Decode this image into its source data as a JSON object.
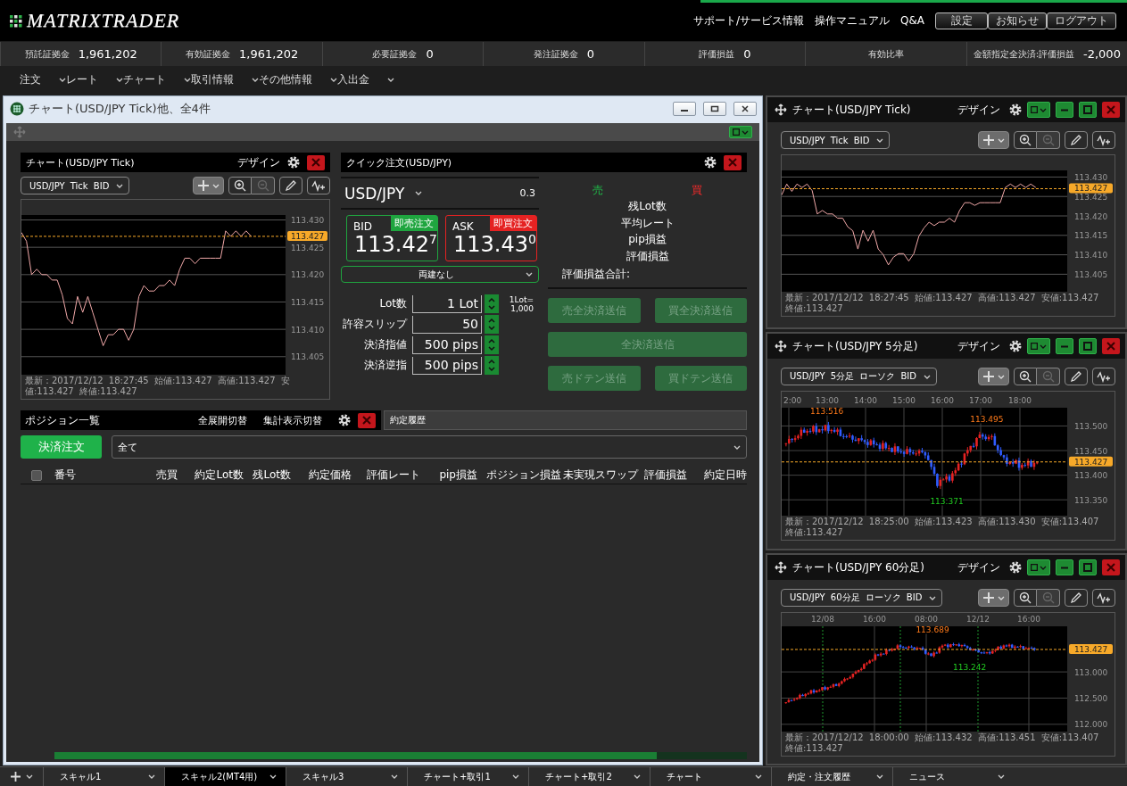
{
  "header": {
    "logo": "MATRIXTRADER",
    "links": [
      "サポート/サービス情報",
      "操作マニュアル",
      "Q&A"
    ],
    "buttons": [
      "設定",
      "お知らせ",
      "ログアウト"
    ]
  },
  "account": [
    {
      "label": "預託証拠金",
      "value": "1,961,202"
    },
    {
      "label": "有効証拠金",
      "value": "1,961,202"
    },
    {
      "label": "必要証拠金",
      "value": "0"
    },
    {
      "label": "発注証拠金",
      "value": "0"
    },
    {
      "label": "評価損益",
      "value": "0"
    },
    {
      "label": "有効比率"
    },
    {
      "label": "金額指定全決済:評価損益",
      "value": "-2,000"
    }
  ],
  "menu": [
    "注文",
    "レート",
    "チャート",
    "取引情報",
    "その他情報",
    "入出金"
  ],
  "main_window": {
    "title": "チャート(USD/JPY Tick)他、全4件",
    "tick_chart": {
      "title": "チャート(USD/JPY Tick)",
      "design": "デザイン",
      "symbol": "USD/JPY Tick BID",
      "tools": [
        {
          "kind": "crosshair",
          "selected": true,
          "disabled": false
        },
        {
          "kind": "zoom_in",
          "selected": false,
          "disabled": false
        },
        {
          "kind": "zoom_out",
          "selected": false,
          "disabled": true
        },
        {
          "kind": "pencil",
          "selected": false,
          "disabled": false
        },
        {
          "kind": "indicator",
          "selected": false,
          "disabled": false
        }
      ],
      "status": "最新：2017/12/12 18:27:45 始値:113.427 高値:113.427 安値:113.427 終値:113.427",
      "chart_data": {
        "type": "line",
        "ylim": [
          113.4017,
          113.4309
        ],
        "values": [
          113.4277,
          113.4261,
          113.42,
          113.421,
          113.42,
          113.42,
          113.419,
          113.419,
          113.4163,
          113.412,
          113.411,
          113.416,
          113.4131,
          113.416,
          113.413,
          113.41,
          113.407,
          113.409,
          113.409,
          113.41,
          113.41,
          113.408,
          113.41,
          113.416,
          113.418,
          113.417,
          113.417,
          113.418,
          113.418,
          113.419,
          113.418,
          113.421,
          113.423,
          113.423,
          113.422,
          113.423,
          113.423,
          113.423,
          113.423,
          113.423,
          113.428,
          113.427,
          113.428,
          113.427,
          113.428,
          113.427
        ],
        "yticks": [
          {
            "value": 113.43,
            "label": "113.430"
          },
          {
            "value": 113.425,
            "label": "113.425"
          },
          {
            "value": 113.42,
            "label": "113.420"
          },
          {
            "value": 113.415,
            "label": "113.415"
          },
          {
            "value": 113.41,
            "label": "113.410"
          },
          {
            "value": 113.405,
            "label": "113.405"
          }
        ],
        "grid": true,
        "ref_lines": [
          {
            "axis": "y",
            "value": 113.427,
            "label": "113.427"
          }
        ]
      }
    },
    "quick_order": {
      "title": "クイック注文(USD/JPY)",
      "pair": "USD/JPY",
      "spread": "0.3",
      "bid": {
        "label": "BID",
        "action": "即売注文",
        "price": "113.42$^{7}$"
      },
      "ask": {
        "label": "ASK",
        "action": "即買注文",
        "price": "113.43$^{0}$"
      },
      "hedge": "両建なし",
      "fields": [
        {
          "label": "Lot数",
          "value": "1 Lot"
        },
        {
          "label": "許容スリップ",
          "value": "50"
        },
        {
          "label": "決済指値",
          "value": "500 pips"
        },
        {
          "label": "決済逆指",
          "value": "500 pips"
        }
      ],
      "lot_note": "1Lot= 1,000",
      "sell": "売",
      "buy": "買",
      "summary": [
        "残Lot数",
        "平均レート",
        "pip損益",
        "評価損益"
      ],
      "total_label": "評価損益合計:",
      "actions": [
        {
          "label": "売全決済送信",
          "disabled": true
        },
        {
          "label": "買全決済送信",
          "disabled": true
        },
        {
          "label": "全決済送信",
          "disabled": true
        },
        {
          "label": "売ドテン送信",
          "disabled": true
        },
        {
          "label": "買ドテン送信",
          "disabled": true
        }
      ]
    },
    "positions": {
      "title": "ポジション一覧",
      "toggles": [
        "全展開切替",
        "集計表示切替"
      ],
      "history_tab": "約定履歴",
      "settle_button": "決済注文",
      "filter": "全て",
      "select_all": {
        "checked": false
      },
      "columns": [
        "番号",
        "売買",
        "約定Lot数",
        "残Lot数",
        "約定価格",
        "評価レート",
        "pip損益",
        "ポジション損益",
        "未実現スワップ",
        "評価損益",
        "約定日時"
      ]
    }
  },
  "side_charts": [
    {
      "kind": "line",
      "title": "チャート(USD/JPY Tick)",
      "design": "デザイン",
      "symbol": "USD/JPY Tick BID",
      "tools": [
        {
          "kind": "crosshair",
          "selected": true,
          "disabled": false
        },
        {
          "kind": "zoom_in",
          "selected": false,
          "disabled": false
        },
        {
          "kind": "zoom_out",
          "selected": false,
          "disabled": true
        },
        {
          "kind": "pencil",
          "selected": false,
          "disabled": false
        },
        {
          "kind": "indicator",
          "selected": false,
          "disabled": false
        }
      ],
      "status": "最新：2017/12/12 18:27:45 始値:113.427 高値:113.427 安値:113.427 終値:113.427",
      "chart_data": {
        "type": "line",
        "ylim": [
          113.4005,
          113.4317
        ],
        "values": [
          113.4254,
          113.4282,
          113.4263,
          113.4282,
          113.4273,
          113.4282,
          113.4265,
          113.4205,
          113.4214,
          113.4205,
          113.4205,
          113.4194,
          113.4194,
          113.4172,
          113.4162,
          113.4115,
          113.4163,
          113.4135,
          113.4163,
          113.4115,
          113.41,
          113.4074,
          113.4094,
          113.4103,
          113.4103,
          113.4084,
          113.4103,
          113.4148,
          113.4169,
          113.4184,
          113.4175,
          113.4184,
          113.4184,
          113.4194,
          113.4184,
          113.4214,
          113.4234,
          113.4234,
          113.4227,
          113.4234,
          113.4234,
          113.4234,
          113.4234,
          113.4234,
          113.4273,
          113.4282,
          113.4273,
          113.4282,
          113.4273,
          113.4282,
          113.4273
        ],
        "yticks": [
          {
            "value": 113.43,
            "label": "113.430"
          },
          {
            "value": 113.425,
            "label": "113.425"
          },
          {
            "value": 113.42,
            "label": "113.420"
          },
          {
            "value": 113.415,
            "label": "113.415"
          },
          {
            "value": 113.41,
            "label": "113.410"
          },
          {
            "value": 113.405,
            "label": "113.405"
          }
        ],
        "grid": true,
        "ref_lines": [
          {
            "axis": "y",
            "value": 113.427,
            "label": "113.427"
          }
        ]
      }
    },
    {
      "kind": "candle",
      "title": "チャート(USD/JPY 5分足)",
      "design": "デザイン",
      "symbol": "USD/JPY 5分足 ローソク BID",
      "tools": [
        {
          "kind": "crosshair",
          "selected": true,
          "disabled": false
        },
        {
          "kind": "zoom_in",
          "selected": false,
          "disabled": false
        },
        {
          "kind": "zoom_out",
          "selected": false,
          "disabled": true
        },
        {
          "kind": "pencil",
          "selected": false,
          "disabled": false
        },
        {
          "kind": "indicator",
          "selected": false,
          "disabled": false
        }
      ],
      "x_labels": [
        "2:00",
        "13:00",
        "14:00",
        "15:00",
        "16:00",
        "17:00",
        "18:00"
      ],
      "y_labels": [
        "113.500",
        "113.450",
        "113.400",
        "113.350"
      ],
      "current": "113.427",
      "price_labels": [
        {
          "kind": "high",
          "text": "113.516"
        },
        {
          "kind": "high",
          "text": "113.495"
        },
        {
          "kind": "low",
          "text": "113.371"
        }
      ],
      "status": "最新：2017/12/12 18:25:00 始値:113.423 高値:113.430 安値:113.407 終値:113.427"
    },
    {
      "kind": "candle",
      "title": "チャート(USD/JPY 60分足)",
      "design": "デザイン",
      "symbol": "USD/JPY 60分足 ローソク BID",
      "tools": [
        {
          "kind": "crosshair",
          "selected": true,
          "disabled": false
        },
        {
          "kind": "zoom_in",
          "selected": false,
          "disabled": false
        },
        {
          "kind": "zoom_out",
          "selected": false,
          "disabled": true
        },
        {
          "kind": "pencil",
          "selected": false,
          "disabled": false
        },
        {
          "kind": "indicator",
          "selected": false,
          "disabled": false
        }
      ],
      "x_labels": [
        "12/08",
        "16:00",
        "08:00",
        "12/12",
        "16:00"
      ],
      "y_labels": [
        "113.000",
        "112.500",
        "112.000"
      ],
      "current": "113.427",
      "price_labels": [
        {
          "kind": "high",
          "text": "113.689"
        },
        {
          "kind": "low",
          "text": "113.242"
        }
      ],
      "status": "最新：2017/12/12 18:00:00 始値:113.432 高値:113.451 安値:113.407 終値:113.427"
    }
  ],
  "tabs": [
    {
      "label": "スキャル1",
      "selected": false
    },
    {
      "label": "スキャル2(MT4用)",
      "selected": true
    },
    {
      "label": "スキャル3",
      "selected": false
    },
    {
      "label": "チャート+取引1",
      "selected": false
    },
    {
      "label": "チャート+取引2",
      "selected": false
    },
    {
      "label": "チャート",
      "selected": false
    },
    {
      "label": "約定・注文履歴",
      "selected": false
    },
    {
      "label": "ニュース",
      "selected": false
    }
  ]
}
